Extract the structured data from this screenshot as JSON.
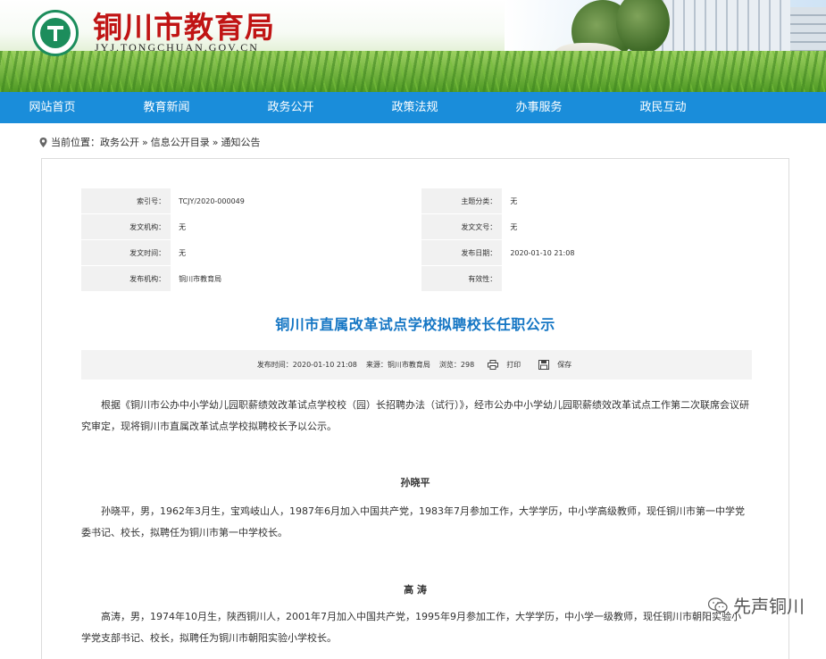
{
  "header": {
    "site_title": "铜川市教育局",
    "site_domain": "JYJ.TONGCHUAN.GOV.CN"
  },
  "nav": {
    "items": [
      "网站首页",
      "教育新闻",
      "政务公开",
      "政策法规",
      "办事服务",
      "政民互动"
    ]
  },
  "breadcrumb": {
    "label": "当前位置：",
    "items": [
      "政务公开",
      "信息公开目录",
      "通知公告"
    ]
  },
  "meta": {
    "rows": [
      {
        "k1": "索引号：",
        "v1": "TCJY/2020-000049",
        "k2": "主题分类：",
        "v2": "无"
      },
      {
        "k1": "发文机构：",
        "v1": "无",
        "k2": "发文文号：",
        "v2": "无"
      },
      {
        "k1": "发文时间：",
        "v1": "无",
        "k2": "发布日期：",
        "v2": "2020-01-10 21:08"
      },
      {
        "k1": "发布机构：",
        "v1": "铜川市教育局",
        "k2": "有效性：",
        "v2": ""
      }
    ]
  },
  "article": {
    "title": "铜川市直属改革试点学校拟聘校长任职公示",
    "info": {
      "publish_time": "发布时间：2020-01-10 21:08",
      "source": "来源：铜川市教育局",
      "views": "浏览：298",
      "print_label": "打印",
      "save_label": "保存"
    },
    "intro": "根据《铜川市公办中小学幼儿园职薪绩效改革试点学校校（园）长招聘办法（试行）》，经市公办中小学幼儿园职薪绩效改革试点工作第二次联席会议研究审定，现将铜川市直属改革试点学校拟聘校长予以公示。",
    "persons": [
      {
        "name": "孙晓平",
        "bio": "孙晓平，男，1962年3月生，宝鸡岐山人，1987年6月加入中国共产党，1983年7月参加工作，大学学历，中小学高级教师，现任铜川市第一中学党委书记、校长，拟聘任为铜川市第一中学校长。"
      },
      {
        "name": "高 涛",
        "bio": "高涛，男，1974年10月生，陕西铜川人，2001年7月加入中国共产党，1995年9月参加工作，大学学历，中小学一级教师，现任铜川市朝阳实验小学党支部书记、校长，拟聘任为铜川市朝阳实验小学校长。"
      }
    ]
  },
  "watermark": {
    "text": "先声铜川"
  },
  "colors": {
    "nav_bg": "#1a8dda",
    "title_red": "#c01414",
    "article_title_blue": "#1576c4",
    "logo_green": "#1c8d5c"
  }
}
